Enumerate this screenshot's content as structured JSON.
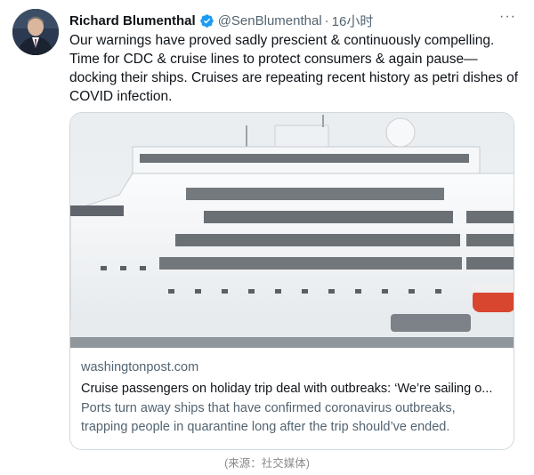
{
  "tweet": {
    "author_name": "Richard Blumenthal",
    "handle": "@SenBlumenthal",
    "separator": "·",
    "timestamp": "16小时",
    "more_label": "···",
    "text": "Our warnings have proved sadly prescient & continuously compelling. Time for CDC & cruise lines to protect consumers & again pause—docking their ships. Cruises are repeating recent history as petri dishes of COVID infection.",
    "verified_icon": "verified-badge-icon",
    "verified_color": "#1d9bf0"
  },
  "card": {
    "domain": "washingtonpost.com",
    "title": "Cruise passengers on holiday trip deal with outbreaks: ‘We’re sailing o...",
    "description": "Ports turn away ships that have confirmed coronavirus outbreaks, trapping people in quarantine long after the trip should’ve ended."
  },
  "caption": "(来源：社交媒体)",
  "colors": {
    "text_primary": "#0f1419",
    "text_secondary": "#536471",
    "border": "#cfd9de",
    "ship_hull": "#f2f4f6",
    "sea": "#8f969c"
  }
}
